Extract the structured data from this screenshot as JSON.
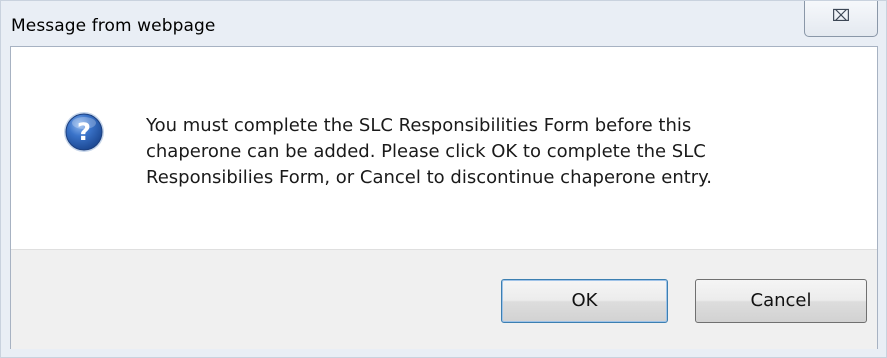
{
  "dialog": {
    "title": "Message from webpage",
    "close_label": "⌧",
    "message": "You must complete the SLC Responsibilities Form before this\nchaperone can be added.  Please click OK to complete the SLC\nResponsibilies Form, or Cancel to discontinue chaperone entry.",
    "icon": "question-icon",
    "ok_label": "OK",
    "cancel_label": "Cancel"
  },
  "colors": {
    "frame": "#e9eef5",
    "icon_blue": "#2a63b8",
    "footer": "#f0f0f0"
  }
}
